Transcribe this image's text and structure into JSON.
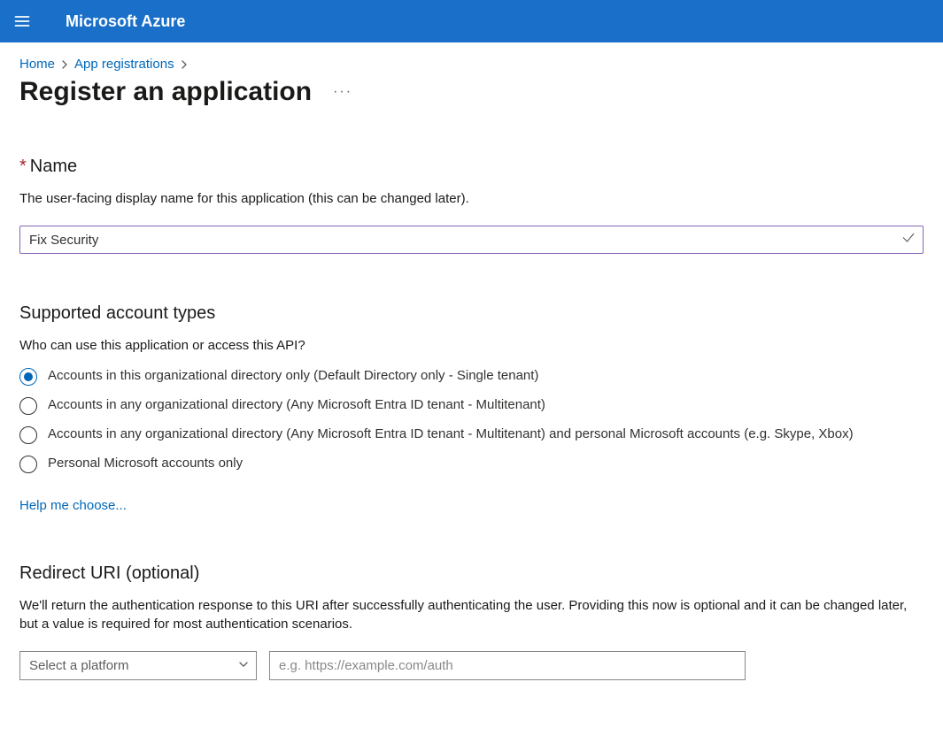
{
  "header": {
    "brand": "Microsoft Azure"
  },
  "breadcrumb": {
    "home": "Home",
    "appreg": "App registrations"
  },
  "title": "Register an application",
  "name_section": {
    "label": "Name",
    "desc": "The user-facing display name for this application (this can be changed later).",
    "value": "Fix Security"
  },
  "accounts": {
    "heading": "Supported account types",
    "question": "Who can use this application or access this API?",
    "options": [
      "Accounts in this organizational directory only (Default Directory only - Single tenant)",
      "Accounts in any organizational directory (Any Microsoft Entra ID tenant - Multitenant)",
      "Accounts in any organizational directory (Any Microsoft Entra ID tenant - Multitenant) and personal Microsoft accounts (e.g. Skype, Xbox)",
      "Personal Microsoft accounts only"
    ],
    "help_link": "Help me choose..."
  },
  "redirect": {
    "heading": "Redirect URI (optional)",
    "desc": "We'll return the authentication response to this URI after successfully authenticating the user. Providing this now is optional and it can be changed later, but a value is required for most authentication scenarios.",
    "platform_placeholder": "Select a platform",
    "uri_placeholder": "e.g. https://example.com/auth"
  }
}
